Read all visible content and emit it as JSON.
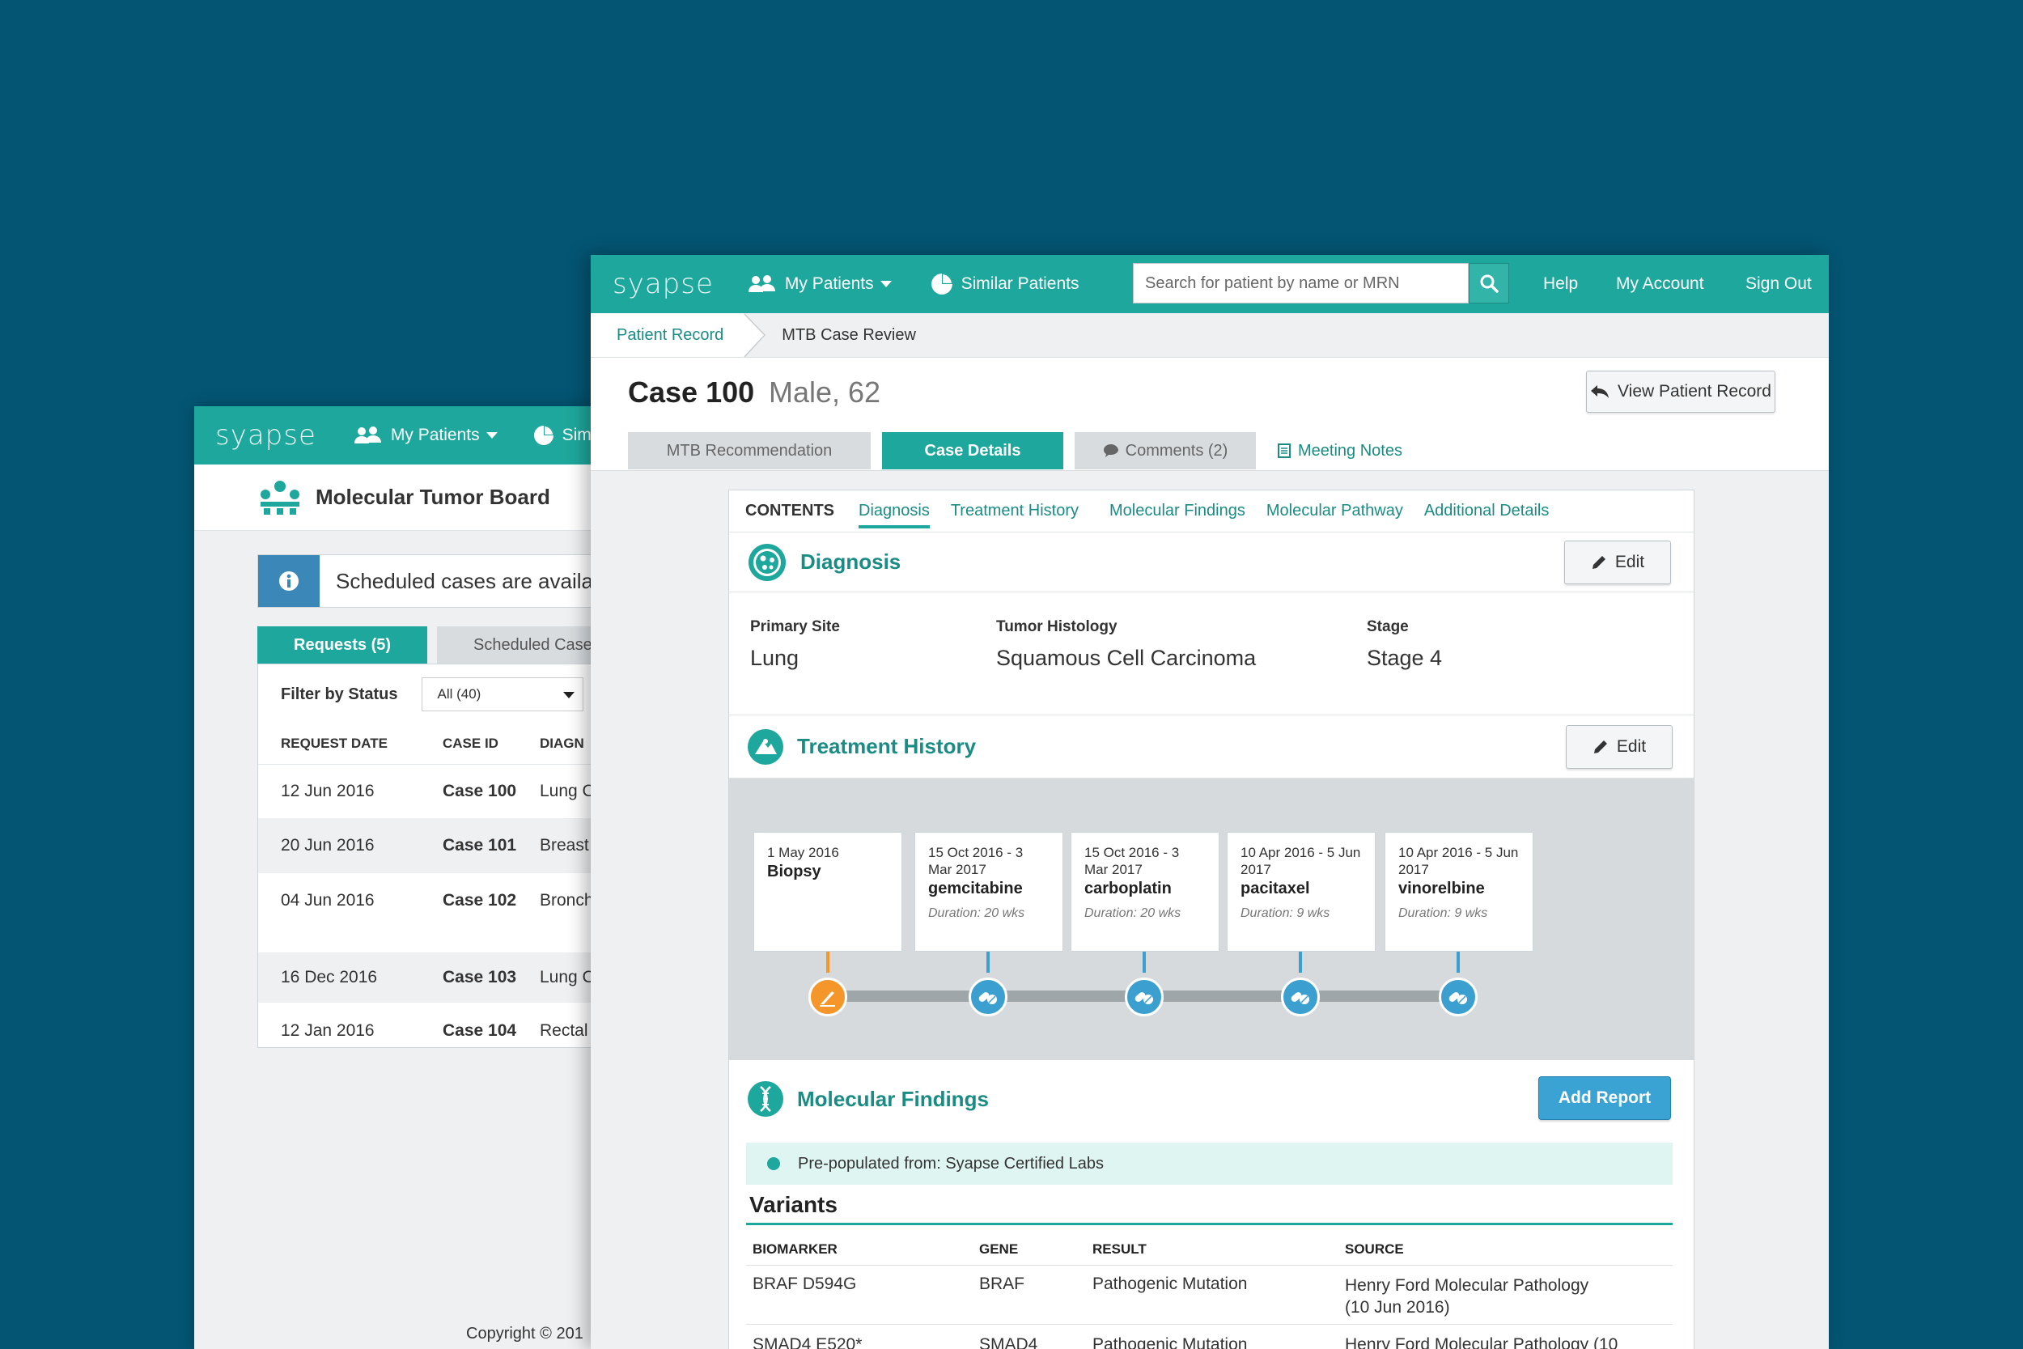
{
  "back_window": {
    "logo": "syapse",
    "nav": {
      "my_patients": "My Patients",
      "similar_partial": "Sim"
    },
    "title": "Molecular Tumor Board",
    "alert": "Scheduled cases are availal",
    "tabs": {
      "requests": "Requests (5)",
      "scheduled": "Scheduled Case"
    },
    "filter": {
      "label": "Filter by Status",
      "value": "All (40)"
    },
    "table": {
      "headers": [
        "REQUEST DATE",
        "CASE ID",
        "DIAGN"
      ],
      "rows": [
        {
          "date": "12 Jun 2016",
          "case": "Case 100",
          "diag": "Lung C"
        },
        {
          "date": "20 Jun 2016",
          "case": "Case 101",
          "diag": "Breast"
        },
        {
          "date": "04 Jun 2016",
          "case": "Case 102",
          "diag": "Bronch"
        },
        {
          "date": "16 Dec 2016",
          "case": "Case 103",
          "diag": "Lung C"
        },
        {
          "date": "12 Jan 2016",
          "case": "Case 104",
          "diag": "Rectal"
        }
      ]
    },
    "copyright": "Copyright © 201"
  },
  "front_window": {
    "logo": "syapse",
    "nav": {
      "my_patients": "My Patients",
      "similar_patients": "Similar Patients",
      "search_placeholder": "Search for patient by name or MRN",
      "help": "Help",
      "my_account": "My Account",
      "sign_out": "Sign Out"
    },
    "breadcrumb": {
      "first": "Patient Record",
      "second": "MTB Case Review"
    },
    "case": {
      "title": "Case 100",
      "subtitle": "Male, 62",
      "view_record": "View Patient Record"
    },
    "tabs": {
      "mtb": "MTB Recommendation",
      "case_details": "Case Details",
      "comments": "Comments (2)",
      "meeting_notes": "Meeting Notes"
    },
    "contents": {
      "label": "CONTENTS",
      "links": [
        "Diagnosis",
        "Treatment History",
        "Molecular Findings",
        "Molecular Pathway",
        "Additional Details"
      ]
    },
    "diagnosis": {
      "title": "Diagnosis",
      "edit": "Edit",
      "fields": [
        {
          "label": "Primary Site",
          "value": "Lung"
        },
        {
          "label": "Tumor Histology",
          "value": "Squamous Cell Carcinoma"
        },
        {
          "label": "Stage",
          "value": "Stage 4"
        }
      ]
    },
    "treatment": {
      "title": "Treatment History",
      "edit": "Edit",
      "items": [
        {
          "date": "1 May 2016",
          "name": "Biopsy",
          "duration": ""
        },
        {
          "date": "15 Oct 2016 - 3 Mar 2017",
          "name": "gemcitabine",
          "duration": "Duration: 20 wks"
        },
        {
          "date": "15 Oct 2016 - 3 Mar 2017",
          "name": "carboplatin",
          "duration": "Duration: 20 wks"
        },
        {
          "date": "10 Apr 2016 - 5 Jun 2017",
          "name": "pacitaxel",
          "duration": "Duration: 9 wks"
        },
        {
          "date": "10 Apr 2016 - 5 Jun 2017",
          "name": "vinorelbine",
          "duration": "Duration: 9 wks"
        }
      ]
    },
    "molecular": {
      "title": "Molecular Findings",
      "add_report": "Add Report",
      "prepopulated": "Pre-populated from: Syapse Certified Labs",
      "variants_title": "Variants",
      "headers": [
        "BIOMARKER",
        "GENE",
        "RESULT",
        "SOURCE"
      ],
      "rows": [
        {
          "biomarker": "BRAF D594G",
          "gene": "BRAF",
          "result": "Pathogenic Mutation",
          "source": "Henry Ford Molecular Pathology (10 Jun 2016)"
        },
        {
          "biomarker": "SMAD4 E520*",
          "gene": "SMAD4",
          "result": "Pathogenic Mutation",
          "source": "Henry Ford Molecular Pathology (10"
        }
      ]
    }
  },
  "colors": {
    "background": "#045573",
    "brand": "#1ea79c",
    "accent_blue": "#3aa3d4",
    "biopsy_orange": "#f5962a",
    "treatment_blue": "#3b9fd0"
  }
}
